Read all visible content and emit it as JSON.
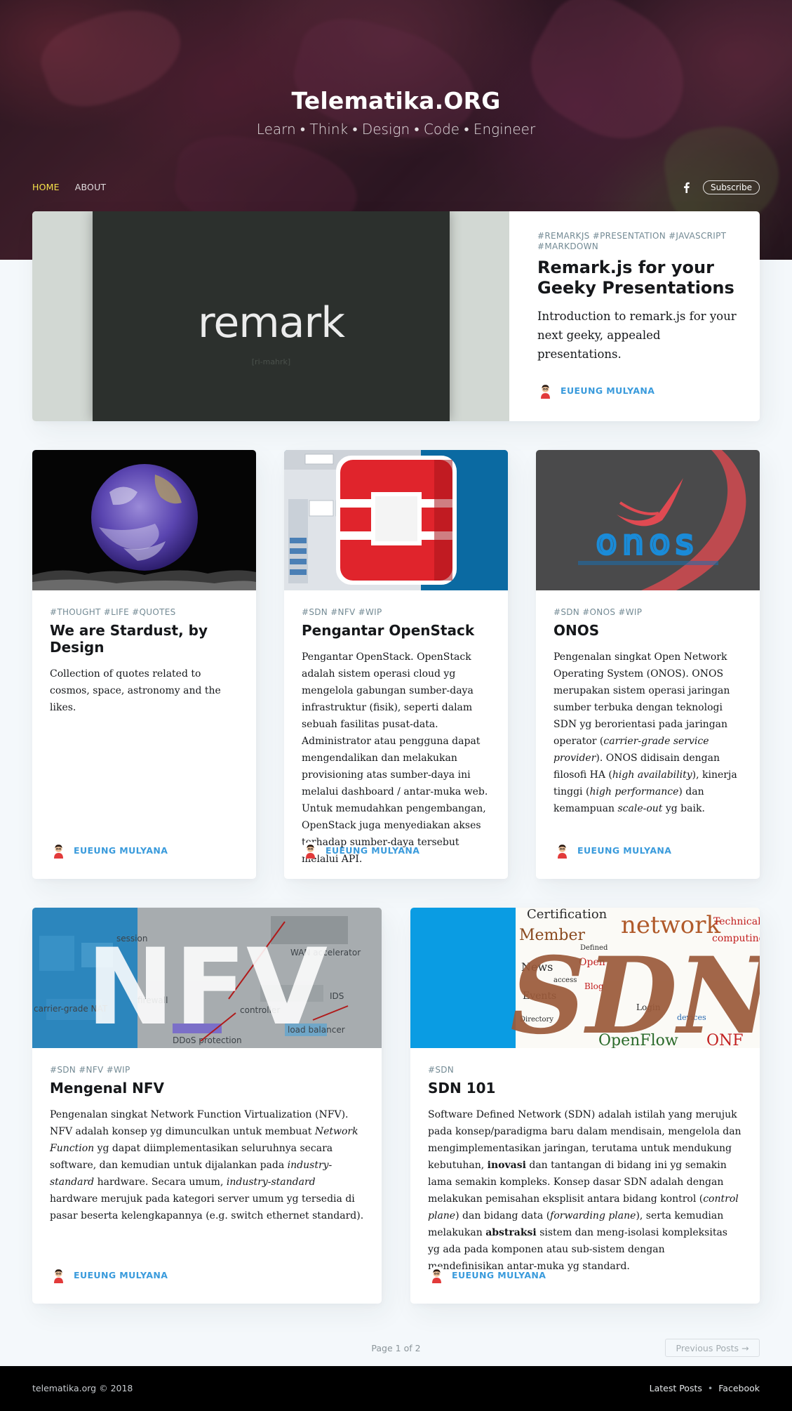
{
  "site": {
    "title": "Telematika.ORG",
    "description": "Learn • Think • Design • Code • Engineer"
  },
  "nav": {
    "items": [
      {
        "label": "HOME",
        "active": true
      },
      {
        "label": "ABOUT",
        "active": false
      }
    ],
    "facebook_icon": "facebook-icon",
    "subscribe_label": "Subscribe"
  },
  "featured": {
    "image_text": "remark",
    "image_subtext": "[ri-mahrk]",
    "tags": "#REMARKJS #PRESENTATION #JAVASCRIPT #MARKDOWN",
    "title": "Remark.js for your Geeky Presentations",
    "excerpt": "Introduction to remark.js for your next geeky, appealed presentations.",
    "author": "EUEUNG MULYANA"
  },
  "posts": [
    {
      "tags": "#THOUGHT #LIFE #QUOTES",
      "title": "We are Stardust, by Design",
      "excerpt": "Collection of quotes related to cosmos, space, astronomy and the likes.",
      "author": "EUEUNG MULYANA"
    },
    {
      "tags": "#SDN #NFV #WIP",
      "title": "Pengantar OpenStack",
      "excerpt": "Pengantar OpenStack. OpenStack adalah sistem operasi cloud yg mengelola gabungan sumber-daya infrastruktur (fisik), seperti dalam sebuah fasilitas pusat-data. Administrator atau pengguna dapat mengendalikan dan melakukan provisioning atas sumber-daya ini melalui dashboard / antar-muka web. Untuk memudahkan pengembangan, OpenStack juga menyediakan akses terhadap sumber-daya tersebut melalui API.",
      "author": "EUEUNG MULYANA"
    },
    {
      "tags": "#SDN #ONOS #WIP",
      "title": "ONOS",
      "excerpt_parts": [
        {
          "t": "Pengenalan singkat Open Network Operating System (ONOS). ONOS merupakan sistem operasi jaringan sumber terbuka dengan teknologi SDN yg berorientasi pada jaringan operator ("
        },
        {
          "i": "carrier-grade service provider"
        },
        {
          "t": "). ONOS didisain dengan filosofi HA ("
        },
        {
          "i": "high availability"
        },
        {
          "t": "), kinerja tinggi ("
        },
        {
          "i": "high performance"
        },
        {
          "t": ") dan kemampuan "
        },
        {
          "i": "scale-out"
        },
        {
          "t": " yg baik."
        }
      ],
      "image_text": "onos",
      "author": "EUEUNG MULYANA"
    },
    {
      "tags": "#SDN #NFV #WIP",
      "title": "Mengenal NFV",
      "excerpt_parts": [
        {
          "t": "Pengenalan singkat Network Function Virtualization (NFV). NFV adalah konsep yg dimunculkan untuk membuat "
        },
        {
          "i": "Network Function"
        },
        {
          "t": " yg dapat diimplementasikan seluruhnya secara software, dan kemudian untuk dijalankan pada "
        },
        {
          "i": "industry-standard"
        },
        {
          "t": " hardware. Secara umum, "
        },
        {
          "i": "industry-standard"
        },
        {
          "t": " hardware merujuk pada kategori server umum yg tersedia di pasar beserta kelengkapannya (e.g. switch ethernet standard)."
        }
      ],
      "image_text": "NFV",
      "image_labels": [
        "carrier-grade NAT",
        "WAN accelerator",
        "DDoS protection",
        "load balancer",
        "IDS",
        "firewall",
        "session",
        "controller"
      ],
      "author": "EUEUNG MULYANA"
    },
    {
      "tags": "#SDN",
      "title": "SDN 101",
      "excerpt_parts": [
        {
          "t": "Software Defined Network (SDN) adalah istilah yang merujuk pada konsep/paradigma baru dalam mendisain, mengelola dan mengimplementasikan jaringan, terutama untuk mendukung kebutuhan, "
        },
        {
          "b": "inovasi"
        },
        {
          "t": " dan tantangan di bidang ini yg semakin lama semakin kompleks. Konsep dasar SDN adalah dengan melakukan pemisahan eksplisit antara bidang kontrol ("
        },
        {
          "i": "control plane"
        },
        {
          "t": ") dan bidang data ("
        },
        {
          "i": "forwarding plane"
        },
        {
          "t": "), serta kemudian melakukan "
        },
        {
          "b": "abstraksi"
        },
        {
          "t": " sistem dan meng-isolasi kompleksitas yg ada pada komponen atau sub-sistem dengan mendefinisikan antar-muka yg standard."
        }
      ],
      "image_text": "SDN",
      "image_words": [
        "Certification",
        "network",
        "Technical",
        "Member",
        "computing",
        "News",
        "Events",
        "Blog",
        "Login",
        "OpenFlow",
        "ONF",
        "Open",
        "Defined",
        "devices",
        "access",
        "Directory"
      ],
      "author": "EUEUNG MULYANA"
    }
  ],
  "pagination": {
    "page_label": "Page 1 of 2",
    "prev_label": "Previous Posts →"
  },
  "footer": {
    "copyright": "telematika.org © 2018",
    "links": [
      "Latest Posts",
      "Facebook"
    ],
    "separator": "•"
  },
  "colors": {
    "accent_link": "#3a9bdc",
    "nav_active": "#f7e34a",
    "tags": "#738a94",
    "background": "#f4f8fb"
  }
}
